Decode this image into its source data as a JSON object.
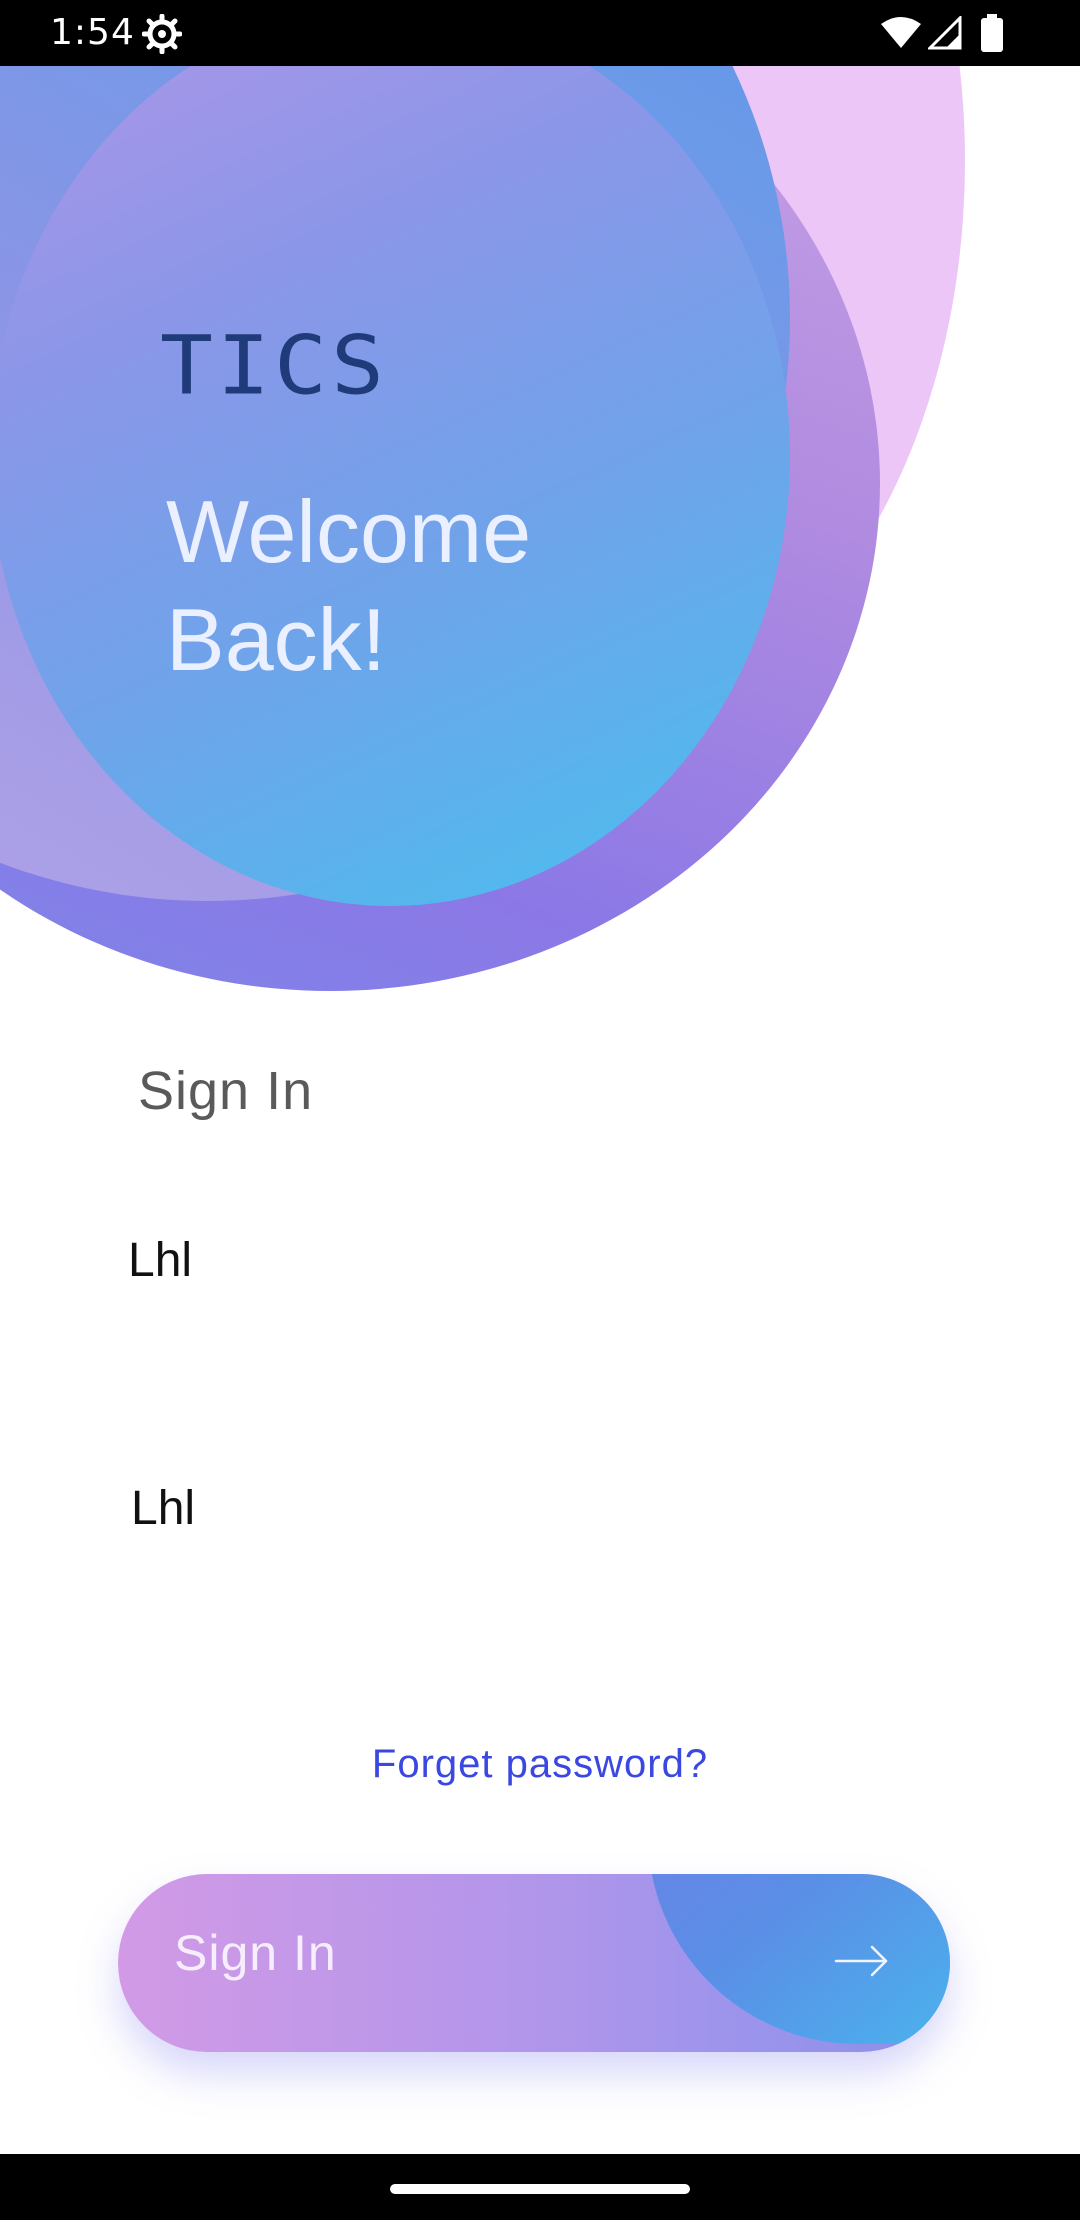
{
  "status_bar": {
    "time": "1:54",
    "icons": [
      "settings-icon",
      "wifi-icon",
      "signal-icon",
      "battery-icon"
    ]
  },
  "header": {
    "brand": "TICS",
    "welcome_line1": "Welcome",
    "welcome_line2": "Back!"
  },
  "form": {
    "heading": "Sign In",
    "username_value": "Lhl",
    "password_value": "Lhl",
    "forgot_label": "Forget password?"
  },
  "button": {
    "signin_label": "Sign In",
    "icon": "arrow-right-icon"
  },
  "colors": {
    "brand_text": "#1f3b7a",
    "link": "#3a47e0",
    "button_start": "#d29ae6",
    "button_end": "#8a8fe8",
    "accent_cyan": "#48c0ee"
  }
}
